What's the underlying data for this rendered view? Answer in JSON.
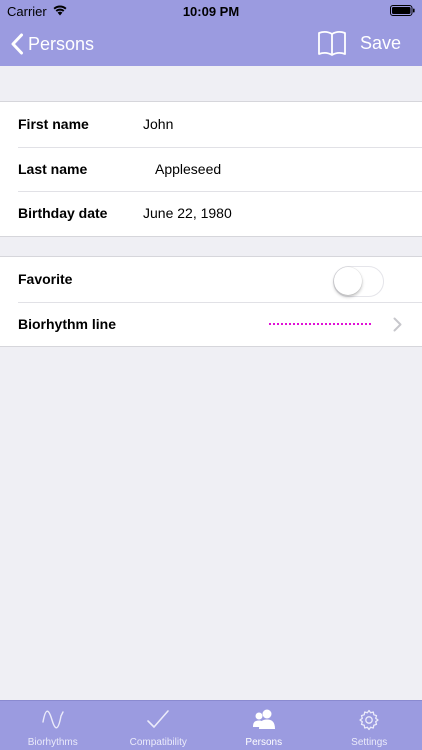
{
  "status_bar": {
    "carrier": "Carrier",
    "time": "10:09 PM"
  },
  "nav_bar": {
    "back_label": "Persons",
    "save_label": "Save",
    "book_icon": "book-icon"
  },
  "person": {
    "first_name_label": "First name",
    "first_name_value": "John",
    "last_name_label": "Last name",
    "last_name_value": "Appleseed",
    "birthday_label": "Birthday date",
    "birthday_value": "June 22, 1980"
  },
  "options": {
    "favorite_label": "Favorite",
    "favorite_on": false,
    "biorhythm_line_label": "Biorhythm line",
    "biorhythm_line_color": "#e011d6"
  },
  "tab_bar": {
    "tabs": [
      {
        "label": "Biorhythms",
        "icon": "wave-icon",
        "active": false
      },
      {
        "label": "Compatibility",
        "icon": "checkmark-icon",
        "active": false
      },
      {
        "label": "Persons",
        "icon": "persons-icon",
        "active": true
      },
      {
        "label": "Settings",
        "icon": "gear-icon",
        "active": false
      }
    ]
  },
  "colors": {
    "accent": "#9b9be0",
    "background": "#efeff4",
    "tab_inactive": "#ebebfa",
    "tab_active": "#ffffff"
  }
}
